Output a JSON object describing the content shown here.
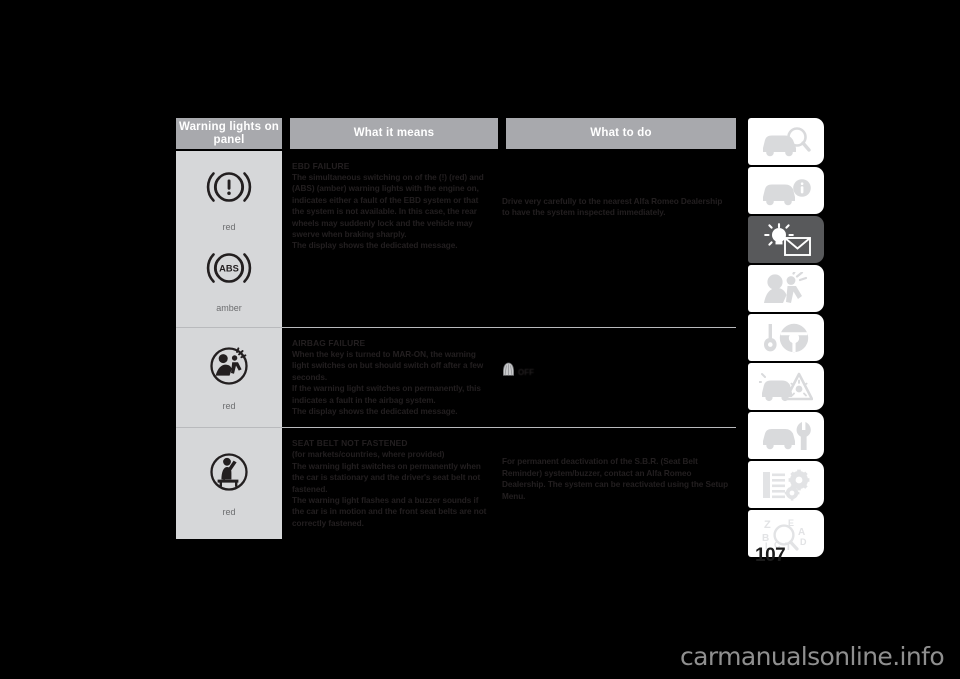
{
  "document": {
    "page_number": "107",
    "watermark": "carmanualsonline.info"
  },
  "table": {
    "headers": [
      {
        "label": "Warning lights on panel",
        "name": "header-warning-lights"
      },
      {
        "label": "What it means",
        "name": "header-what-it-means"
      },
      {
        "label": "What to do",
        "name": "header-what-to-do"
      }
    ],
    "rows": [
      {
        "id": "ebd-failure",
        "icons": [
          {
            "icon": "brake-warning-icon",
            "colour": "red"
          },
          {
            "icon": "abs-warning-icon",
            "colour": "amber"
          }
        ],
        "means_title": "EBD FAILURE",
        "means_body": "The simultaneous switching on of the (!) (red) and (ABS) (amber) warning lights with the engine on, indicates either a fault of the EBD system or that the system is not available. In this case, the rear wheels may suddenly lock and the vehicle may swerve when braking sharply.",
        "means_note": "The display shows the dedicated message.",
        "todo": "Drive very carefully to the nearest Alfa Romeo Dealership to have the system inspected immediately.",
        "todo_symbol": null,
        "todo_symbol_label": null
      },
      {
        "id": "airbag-failure",
        "icons": [
          {
            "icon": "airbag-warning-icon",
            "colour": "red"
          }
        ],
        "means_title": "AIRBAG FAILURE",
        "means_body": "When the key is turned to MAR-ON, the warning light switches on but should switch off after a few seconds.\nIf the warning light switches on permanently, this indicates a fault in the airbag system.",
        "means_note": "The display shows the dedicated message.",
        "todo": null,
        "todo_symbol": "airbag-off-icon",
        "todo_symbol_label": "OFF"
      },
      {
        "id": "seat-belt-not-fastened",
        "icons": [
          {
            "icon": "seat-belt-warning-icon",
            "colour": "red"
          }
        ],
        "means_title": "SEAT BELT NOT FASTENED",
        "means_subtitle": "(for markets/countries, where provided)",
        "means_body": "The warning light switches on permanently when the car is stationary and the driver's seat belt not fastened.\nThe warning light flashes and a buzzer sounds if the car is in motion and the front seat belts are not correctly fastened.",
        "means_note": null,
        "todo": "For permanent deactivation of the S.B.R. (Seat Belt Reminder) system/buzzer, contact an Alfa Romeo Dealership. The system can be reactivated using the Setup Menu.",
        "todo_symbol": null,
        "todo_symbol_label": null
      }
    ]
  },
  "sidetabs": [
    {
      "name": "tab-getting-to-know-the-car",
      "icon": "car-magnifier-icon",
      "active": false
    },
    {
      "name": "tab-dashboard-and-controls",
      "icon": "car-info-icon",
      "active": false
    },
    {
      "name": "tab-warning-lights-and-messages",
      "icon": "warning-lamp-envelope-icon",
      "active": true
    },
    {
      "name": "tab-safety",
      "icon": "airbag-occupant-icon",
      "active": false
    },
    {
      "name": "tab-starting-and-driving",
      "icon": "key-steering-wheel-icon",
      "active": false
    },
    {
      "name": "tab-in-an-emergency",
      "icon": "car-warning-triangle-icon",
      "active": false
    },
    {
      "name": "tab-maintenance-and-care",
      "icon": "car-spanner-icon",
      "active": false
    },
    {
      "name": "tab-technical-specifications",
      "icon": "list-gears-icon",
      "active": false
    },
    {
      "name": "tab-alphabetical-index",
      "icon": "alphabet-magnifier-icon",
      "active": false
    }
  ],
  "colors": {
    "header_bg": "#a8a9ad",
    "icon_cell_bg": "#d6d7d9",
    "active_tab_bg": "#58595b",
    "page_bg": "#000000",
    "text": "#231f20"
  }
}
